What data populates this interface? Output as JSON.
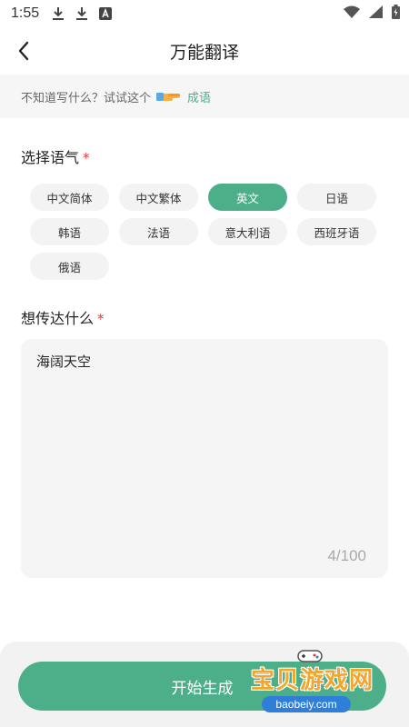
{
  "status_bar": {
    "time": "1:55",
    "left_icons": [
      "download-icon",
      "download-icon",
      "a-badge-icon"
    ],
    "right_icons": [
      "wifi-icon",
      "signal-icon",
      "battery-icon"
    ]
  },
  "header": {
    "title": "万能翻译",
    "back_icon": "chevron-left-icon"
  },
  "tip": {
    "text": "不知道写什么？试试这个",
    "icon": "pointing-hand-icon",
    "link_label": "成语"
  },
  "tone_section": {
    "label": "选择语气",
    "required_mark": "*",
    "options": [
      "中文简体",
      "中文繁体",
      "英文",
      "日语",
      "韩语",
      "法语",
      "意大利语",
      "西班牙语",
      "俄语"
    ],
    "selected": "英文"
  },
  "input_section": {
    "label": "想传达什么",
    "required_mark": "*",
    "value": "海阔天空",
    "char_count": "4/100"
  },
  "footer": {
    "generate_label": "开始生成"
  },
  "watermark": {
    "text": "宝贝游戏网",
    "url": "baobeiy.com"
  },
  "colors": {
    "accent": "#4caf8a",
    "required": "#e53935",
    "chip_bg": "#f3f3f3",
    "input_bg": "#f5f5f5"
  }
}
